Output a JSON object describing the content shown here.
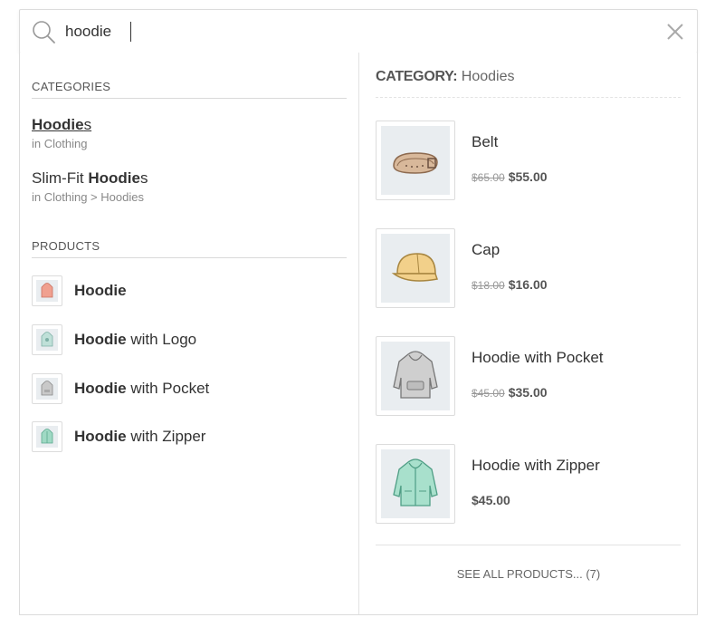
{
  "search": {
    "value": "hoodie",
    "placeholder": ""
  },
  "left": {
    "categories_heading": "Categories",
    "categories": [
      {
        "match": "Hoodie",
        "rest": "s",
        "prefix": "",
        "path": "in Clothing"
      },
      {
        "match": "Hoodie",
        "rest": "s",
        "prefix": "Slim-Fit ",
        "path": "in Clothing > Hoodies"
      }
    ],
    "products_heading": "Products",
    "products": [
      {
        "match": "Hoodie",
        "rest": "",
        "icon": "hoodie-red-icon"
      },
      {
        "match": "Hoodie",
        "rest": " with Logo",
        "icon": "hoodie-logo-icon"
      },
      {
        "match": "Hoodie",
        "rest": " with Pocket",
        "icon": "hoodie-pocket-icon"
      },
      {
        "match": "Hoodie",
        "rest": " with Zipper",
        "icon": "hoodie-zipper-icon"
      }
    ]
  },
  "right": {
    "category_label": "CATEGORY:",
    "category_name": "Hoodies",
    "results": [
      {
        "name": "Belt",
        "old_price": "$65.00",
        "price": "$55.00",
        "icon": "belt-icon"
      },
      {
        "name": "Cap",
        "old_price": "$18.00",
        "price": "$16.00",
        "icon": "cap-icon"
      },
      {
        "name": "Hoodie with Pocket",
        "old_price": "$45.00",
        "price": "$35.00",
        "icon": "hoodie-pocket-icon"
      },
      {
        "name": "Hoodie with Zipper",
        "old_price": "",
        "price": "$45.00",
        "icon": "hoodie-zipper-icon"
      }
    ],
    "see_all": "SEE ALL PRODUCTS... (7)"
  },
  "colors": {
    "border": "#dcdcdc",
    "thumb_bg": "#e9edf0",
    "text": "#333333",
    "muted": "#888888"
  }
}
